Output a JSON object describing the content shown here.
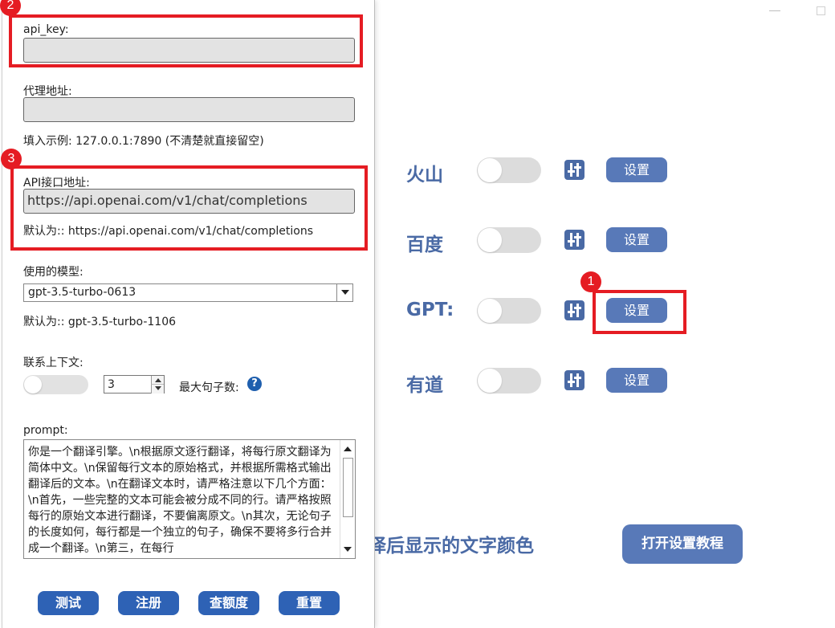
{
  "main": {
    "engines": [
      {
        "label": "火山",
        "button": "设置"
      },
      {
        "label": "百度",
        "button": "设置"
      },
      {
        "label": "GPT:",
        "button": "设置"
      },
      {
        "label": "有道",
        "button": "设置"
      }
    ],
    "color_text": "译后显示的文字颜色",
    "tutorial_button": "打开设置教程"
  },
  "dialog": {
    "api_key_label": "api_key:",
    "api_key_value": "",
    "proxy_label": "代理地址:",
    "proxy_value": "",
    "proxy_hint": "填入示例: 127.0.0.1:7890 (不清楚就直接留空)",
    "api_url_label": "API接口地址:",
    "api_url_value": "https://api.openai.com/v1/chat/completions",
    "api_url_hint": "默认为:: https://api.openai.com/v1/chat/completions",
    "model_label": "使用的模型:",
    "model_selected": "gpt-3.5-turbo-0613",
    "model_hint": "默认为:: gpt-3.5-turbo-1106",
    "context_label": "联系上下文:",
    "max_sentences_value": "3",
    "max_sentences_label": "最大句子数:",
    "help_glyph": "?",
    "prompt_label": "prompt:",
    "prompt_value": "你是一个翻译引擎。\\n根据原文逐行翻译，将每行原文翻译为简体中文。\\n保留每行文本的原始格式，并根据所需格式输出翻译后的文本。\\n在翻译文本时，请严格注意以下几个方面：\\n首先，一些完整的文本可能会被分成不同的行。请严格按照每行的原始文本进行翻译，不要偏离原文。\\n其次，无论句子的长度如何，每行都是一个独立的句子，确保不要将多行合并成一个翻译。\\n第三，在每行",
    "buttons": {
      "test": "测试",
      "register": "注册",
      "quota": "查额度",
      "reset": "重置"
    }
  },
  "annotations": {
    "badge_1": "1",
    "badge_2": "2",
    "badge_3": "3"
  },
  "colors": {
    "accent": "#5879b8",
    "dialog_button": "#2e62b5",
    "annotation_red": "#e51c23",
    "engine_label": "#4a6aa5"
  }
}
